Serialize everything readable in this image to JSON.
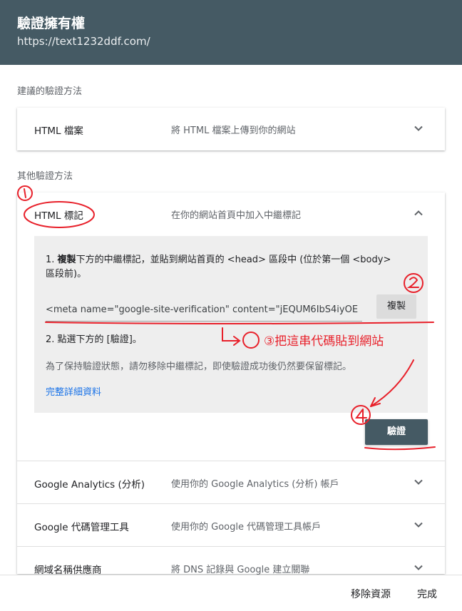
{
  "header": {
    "title": "驗證擁有權",
    "url": "https://text1232ddf.com/"
  },
  "recommended": {
    "label": "建議的驗證方法",
    "method": {
      "name": "HTML 檔案",
      "desc": "將 HTML 檔案上傳到你的網站",
      "icon": "chevron-down-icon"
    }
  },
  "others": {
    "label": "其他驗證方法",
    "html_tag": {
      "name": "HTML 標記",
      "desc": "在你的網站首頁中加入中繼標記",
      "icon": "chevron-up-icon",
      "step1_prefix": "1. ",
      "step1_bold": "複製",
      "step1_text": "下方的中繼標記，並貼到網站首頁的 <head> 區段中 (位於第一個 <body> 區段前)。",
      "meta_value": "<meta name=\"google-site-verification\" content=\"jEQUM6IbS4iyOE",
      "copy_label": "複製",
      "step2": "2. 點選下方的 [驗證]。",
      "note": "為了保持驗證狀態，請勿移除中繼標記，即使驗證成功後仍然要保留標記。",
      "details_link": "完整詳細資料",
      "verify_label": "驗證"
    },
    "methods": [
      {
        "name": "Google Analytics (分析)",
        "desc": "使用你的 Google Analytics (分析) 帳戶"
      },
      {
        "name": "Google 代碼管理工具",
        "desc": "使用你的 Google 代碼管理工具帳戶"
      },
      {
        "name": "網域名稱供應商",
        "desc": "將 DNS 記錄與 Google 建立關聯"
      }
    ]
  },
  "footer": {
    "remove_label": "移除資源",
    "done_label": "完成"
  },
  "annotations": {
    "note3": "③把這串代碼貼到網站",
    "color": "#e8202a"
  },
  "colors": {
    "header_bg": "#455a64",
    "link": "#1a73e8",
    "panel_bg": "#eeeeee"
  }
}
